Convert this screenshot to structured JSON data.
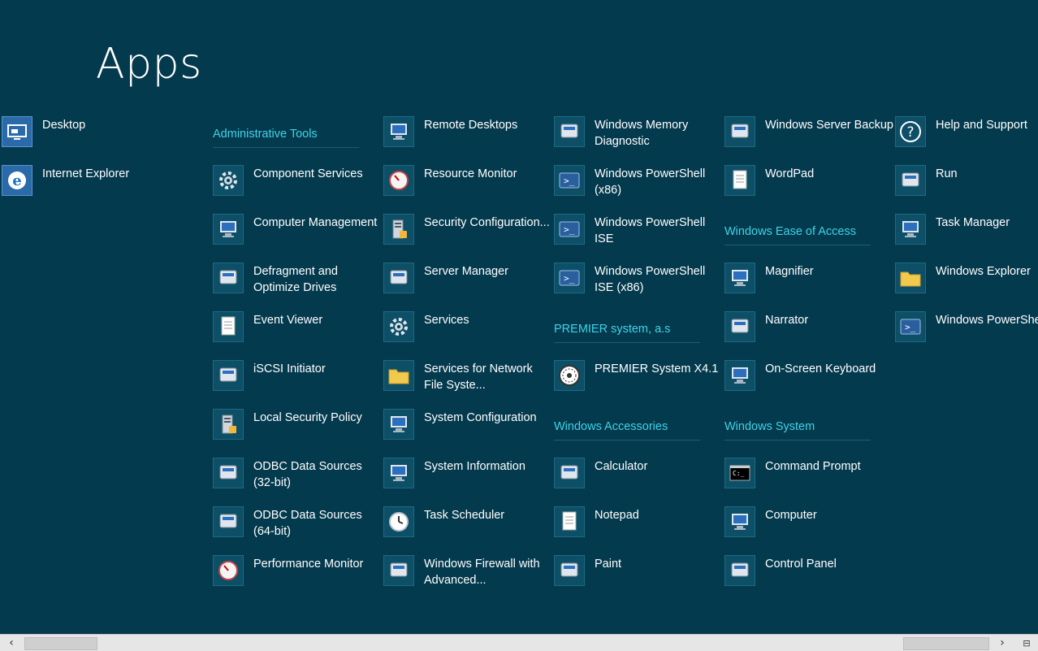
{
  "page": {
    "title": "Apps"
  },
  "col0": [
    {
      "type": "app",
      "label": "Desktop",
      "icon": "desktop-icon"
    },
    {
      "type": "app",
      "label": "Internet Explorer",
      "icon": "internet-explorer-icon"
    }
  ],
  "col1": [
    {
      "type": "group",
      "label": "Administrative Tools"
    },
    {
      "type": "app",
      "label": "Component Services",
      "icon": "component-services-icon"
    },
    {
      "type": "app",
      "label": "Computer Management",
      "icon": "computer-management-icon"
    },
    {
      "type": "app",
      "label": "Defragment and Optimize Drives",
      "icon": "defragment-icon"
    },
    {
      "type": "app",
      "label": "Event Viewer",
      "icon": "event-viewer-icon"
    },
    {
      "type": "app",
      "label": "iSCSI Initiator",
      "icon": "iscsi-initiator-icon"
    },
    {
      "type": "app",
      "label": "Local Security Policy",
      "icon": "local-security-policy-icon"
    },
    {
      "type": "app",
      "label": "ODBC Data Sources (32-bit)",
      "icon": "odbc-32-icon"
    },
    {
      "type": "app",
      "label": "ODBC Data Sources (64-bit)",
      "icon": "odbc-64-icon"
    },
    {
      "type": "app",
      "label": "Performance Monitor",
      "icon": "performance-monitor-icon"
    }
  ],
  "col2": [
    {
      "type": "app",
      "label": "Remote Desktops",
      "icon": "remote-desktops-icon"
    },
    {
      "type": "app",
      "label": "Resource Monitor",
      "icon": "resource-monitor-icon"
    },
    {
      "type": "app",
      "label": "Security Configuration...",
      "icon": "security-configuration-icon"
    },
    {
      "type": "app",
      "label": "Server Manager",
      "icon": "server-manager-icon"
    },
    {
      "type": "app",
      "label": "Services",
      "icon": "services-gear-icon"
    },
    {
      "type": "app",
      "label": "Services for Network File Syste...",
      "icon": "nfs-services-icon"
    },
    {
      "type": "app",
      "label": "System Configuration",
      "icon": "system-configuration-icon"
    },
    {
      "type": "app",
      "label": "System Information",
      "icon": "system-information-icon"
    },
    {
      "type": "app",
      "label": "Task Scheduler",
      "icon": "task-scheduler-clock-icon"
    },
    {
      "type": "app",
      "label": "Windows Firewall with Advanced...",
      "icon": "firewall-icon"
    }
  ],
  "col3": [
    {
      "type": "app",
      "label": "Windows Memory Diagnostic",
      "icon": "memory-diagnostic-icon"
    },
    {
      "type": "app",
      "label": "Windows PowerShell (x86)",
      "icon": "powershell-x86-icon"
    },
    {
      "type": "app",
      "label": "Windows PowerShell ISE",
      "icon": "powershell-ise-icon"
    },
    {
      "type": "app",
      "label": "Windows PowerShell ISE (x86)",
      "icon": "powershell-ise-x86-icon"
    },
    {
      "type": "group",
      "label": "PREMIER system, a.s"
    },
    {
      "type": "app",
      "label": "PREMIER System X4.1",
      "icon": "premier-system-icon"
    },
    {
      "type": "group",
      "label": "Windows Accessories"
    },
    {
      "type": "app",
      "label": "Calculator",
      "icon": "calculator-icon"
    },
    {
      "type": "app",
      "label": "Notepad",
      "icon": "notepad-icon"
    },
    {
      "type": "app",
      "label": "Paint",
      "icon": "paint-palette-icon"
    }
  ],
  "col4": [
    {
      "type": "app",
      "label": "Windows Server Backup",
      "icon": "server-backup-icon"
    },
    {
      "type": "app",
      "label": "WordPad",
      "icon": "wordpad-icon"
    },
    {
      "type": "group",
      "label": "Windows Ease of Access"
    },
    {
      "type": "app",
      "label": "Magnifier",
      "icon": "magnifier-icon"
    },
    {
      "type": "app",
      "label": "Narrator",
      "icon": "narrator-icon"
    },
    {
      "type": "app",
      "label": "On-Screen Keyboard",
      "icon": "on-screen-keyboard-icon"
    },
    {
      "type": "group",
      "label": "Windows System"
    },
    {
      "type": "app",
      "label": "Command Prompt",
      "icon": "command-prompt-icon"
    },
    {
      "type": "app",
      "label": "Computer",
      "icon": "computer-icon"
    },
    {
      "type": "app",
      "label": "Control Panel",
      "icon": "control-panel-icon"
    }
  ],
  "col5": [
    {
      "type": "app",
      "label": "Help and Support",
      "icon": "help-question-icon"
    },
    {
      "type": "app",
      "label": "Run",
      "icon": "run-icon"
    },
    {
      "type": "app",
      "label": "Task Manager",
      "icon": "task-manager-icon"
    },
    {
      "type": "app",
      "label": "Windows Explorer",
      "icon": "folder-icon"
    },
    {
      "type": "app",
      "label": "Windows PowerShell",
      "icon": "powershell-icon"
    }
  ],
  "scrollbar": {
    "left_icon": "chevron-left-icon",
    "right_icon": "chevron-right-icon",
    "zoom_icon": "semantic-zoom-icon"
  }
}
